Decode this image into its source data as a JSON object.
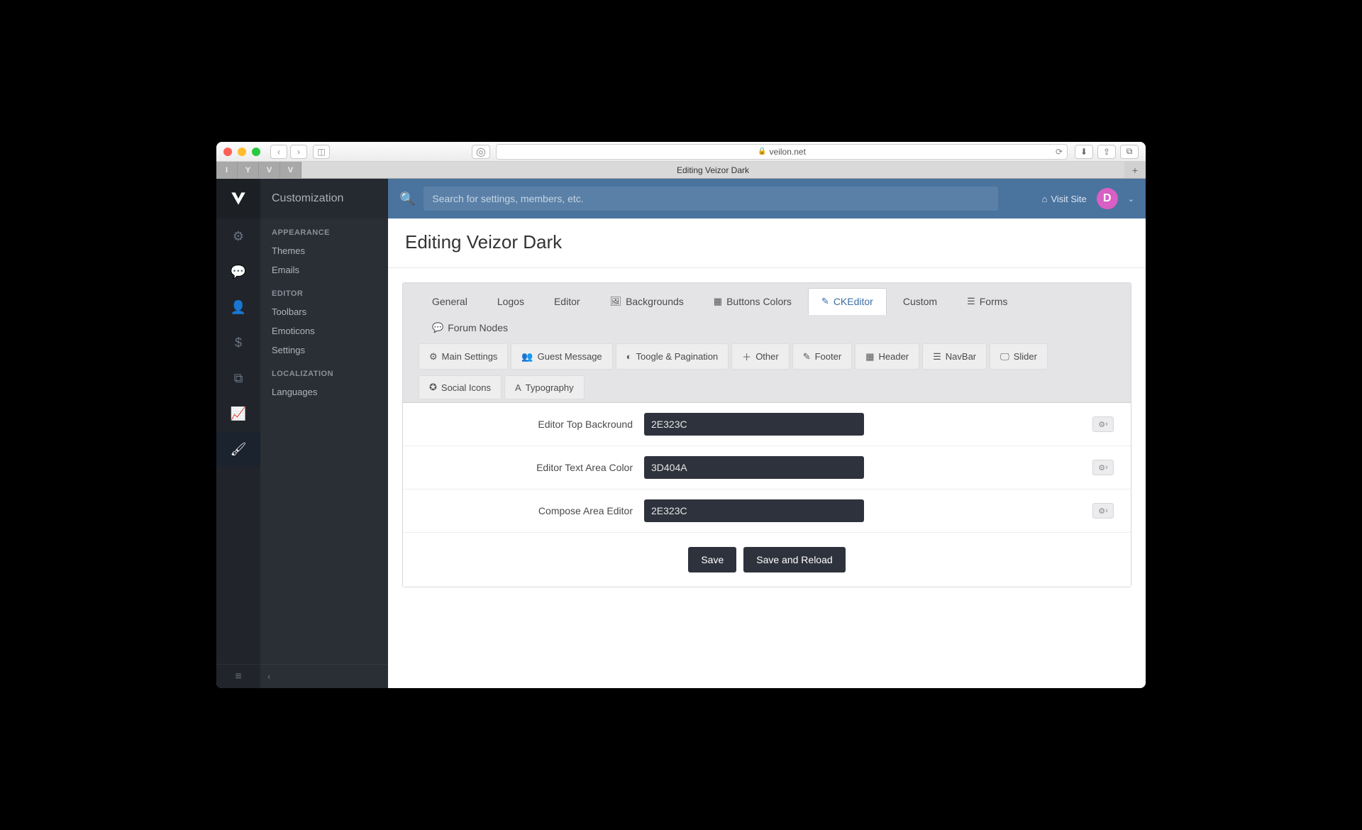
{
  "browser": {
    "url_host": "veilon.net",
    "tab_title": "Editing Veizor Dark",
    "fav_tabs": [
      "I",
      "Y",
      "V",
      "V"
    ]
  },
  "sidebar": {
    "title": "Customization",
    "sections": [
      {
        "heading": "APPEARANCE",
        "items": [
          "Themes",
          "Emails"
        ]
      },
      {
        "heading": "EDITOR",
        "items": [
          "Toolbars",
          "Emoticons",
          "Settings"
        ]
      },
      {
        "heading": "LOCALIZATION",
        "items": [
          "Languages"
        ]
      }
    ],
    "rail_icons": [
      "gears",
      "chat",
      "user",
      "dollar",
      "copy",
      "chart",
      "brush"
    ]
  },
  "topbar": {
    "search_placeholder": "Search for settings, members, etc.",
    "visit_label": "Visit Site",
    "avatar_letter": "D"
  },
  "page": {
    "title": "Editing Veizor Dark"
  },
  "tabs_primary": [
    {
      "label": "General"
    },
    {
      "label": "Logos"
    },
    {
      "label": "Editor"
    },
    {
      "label": "Backgrounds",
      "icon": "image"
    },
    {
      "label": "Buttons Colors",
      "icon": "th"
    },
    {
      "label": "CKEditor",
      "icon": "edit",
      "active": true
    },
    {
      "label": "Custom"
    },
    {
      "label": "Forms",
      "icon": "form"
    },
    {
      "label": "Forum Nodes",
      "icon": "comments"
    }
  ],
  "tabs_secondary": [
    {
      "label": "Main Settings",
      "icon": "cog"
    },
    {
      "label": "Guest Message",
      "icon": "users"
    },
    {
      "label": "Toogle & Pagination",
      "icon": "toggle"
    },
    {
      "label": "Other",
      "icon": "plus"
    },
    {
      "label": "Footer",
      "icon": "pencil"
    },
    {
      "label": "Header",
      "icon": "grid"
    },
    {
      "label": "NavBar",
      "icon": "bars"
    },
    {
      "label": "Slider",
      "icon": "monitor"
    },
    {
      "label": "Social Icons",
      "icon": "share"
    },
    {
      "label": "Typography",
      "icon": "font"
    }
  ],
  "fields": [
    {
      "label": "Editor Top Backround",
      "value": "2E323C"
    },
    {
      "label": "Editor Text Area Color",
      "value": "3D404A"
    },
    {
      "label": "Compose Area Editor",
      "value": "2E323C"
    }
  ],
  "buttons": {
    "save": "Save",
    "save_reload": "Save and Reload"
  }
}
